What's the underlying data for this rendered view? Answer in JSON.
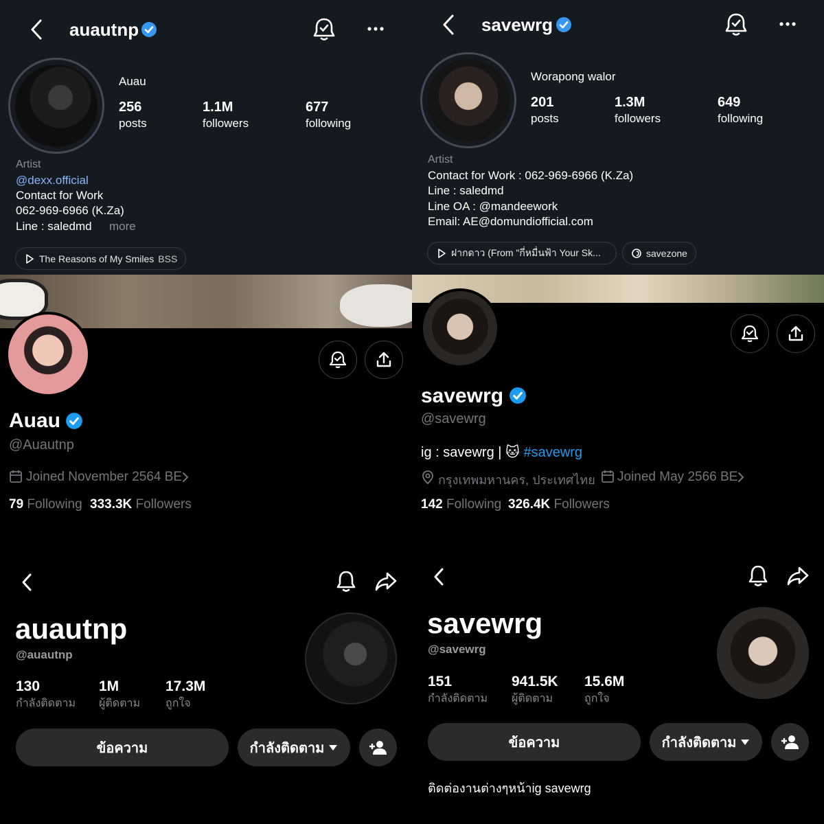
{
  "ig_left": {
    "username": "auautnp",
    "name": "Auau",
    "posts": "256",
    "posts_label": "posts",
    "followers": "1.1M",
    "followers_label": "followers",
    "following": "677",
    "following_label": "following",
    "category": "Artist",
    "link": "@dexx.official",
    "bio1": "Contact for Work",
    "bio2": "062-969-6966 (K.Za)",
    "bio3": "Line : saledmd",
    "more": "more",
    "music": "The Reasons of My Smiles",
    "music_artist": "BSS"
  },
  "ig_right": {
    "username": "savewrg",
    "name": "Worapong walor",
    "posts": "201",
    "posts_label": "posts",
    "followers": "1.3M",
    "followers_label": "followers",
    "following": "649",
    "following_label": "following",
    "category": "Artist",
    "bio1": "Contact for Work : 062-969-6966 (K.Za)",
    "bio2": "Line : saledmd",
    "bio3": "Line OA : @mandeework",
    "bio4": "Email: AE@domundiofficial.com",
    "music": "ฝากดาว (From \"กี่หมื่นฟ้า Your Sk...",
    "threads": "savezone"
  },
  "x_left": {
    "name": "Auau",
    "handle": "@Auautnp",
    "joined": "Joined November 2564 BE",
    "following_count": "79",
    "following_label": "Following",
    "followers_count": "333.3K",
    "followers_label": "Followers"
  },
  "x_right": {
    "name": "savewrg",
    "handle": "@savewrg",
    "bio_prefix": "ig : savewrg |",
    "bio_emoji": "🐱",
    "bio_tag": "#savewrg",
    "location": "กรุงเทพมหานคร, ประเทศไทย",
    "joined": "Joined May 2566 BE",
    "following_count": "142",
    "following_label": "Following",
    "followers_count": "326.4K",
    "followers_label": "Followers"
  },
  "tt_left": {
    "name": "auautnp",
    "handle": "@auautnp",
    "following": "130",
    "following_label": "กำลังติดตาม",
    "followers": "1M",
    "followers_label": "ผู้ติดตาม",
    "likes": "17.3M",
    "likes_label": "ถูกใจ",
    "message_btn": "ข้อความ",
    "follow_btn": "กำลังติดตาม"
  },
  "tt_right": {
    "name": "savewrg",
    "handle": "@savewrg",
    "following": "151",
    "following_label": "กำลังติดตาม",
    "followers": "941.5K",
    "followers_label": "ผู้ติดตาม",
    "likes": "15.6M",
    "likes_label": "ถูกใจ",
    "message_btn": "ข้อความ",
    "follow_btn": "กำลังติดตาม",
    "bio": "ติดต่องานต่างๆหน้าig savewrg"
  },
  "colors": {
    "ig_bg": "#151a21",
    "verified": "#3897f0",
    "link": "#8ab4f8"
  }
}
